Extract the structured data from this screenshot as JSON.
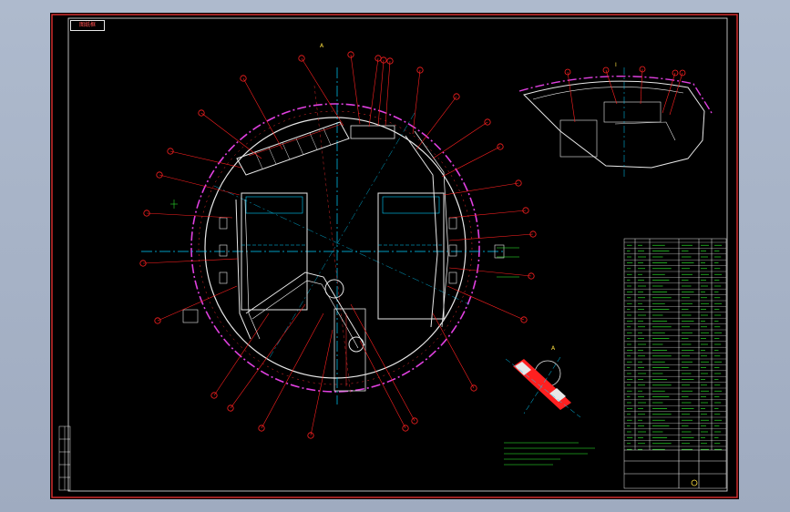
{
  "sheet": {
    "tag_label": "图纸框",
    "view_label": "A",
    "section_label": "I",
    "detail_label": "A"
  },
  "colors": {
    "background": "#000000",
    "frame": "#e03030",
    "ring": "#e040e0",
    "centerline": "#00d0ff",
    "leader": "#ff2020",
    "structure": "#e8e8e8",
    "notes": "#30ff30",
    "pipe": "#ffffff"
  },
  "balloon_count": 40
}
